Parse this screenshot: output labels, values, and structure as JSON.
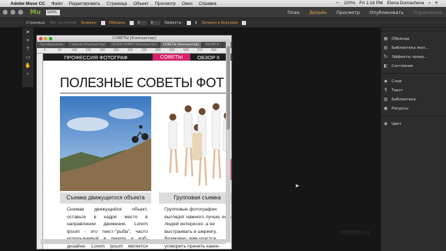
{
  "menubar": {
    "app": "Adobe Muse CC",
    "menus": [
      "Файл",
      "Редактировать",
      "Страница",
      "Объект",
      "Просмотр",
      "Окно",
      "Справка"
    ],
    "battery": "100%",
    "time": "Fri 1:18 PM",
    "user": "Elena Domasheva"
  },
  "appbar": {
    "logo": "Mu",
    "zoom": "100%",
    "tabs": [
      "План",
      "Дизайн",
      "Просмотр",
      "Опубликовать",
      "Управление"
    ],
    "active_tab": "Дизайн"
  },
  "optionsbar": {
    "page_label": "Страница:",
    "page_state": "Нет состояния",
    "fill_label": "Заливка:",
    "stroke_label": "Обводка:",
    "stroke_value": "0",
    "value2": "0",
    "effects_label": "Эффекты:",
    "browser_fill": "Заливка в браузере"
  },
  "tools": [
    "arrow-icon",
    "crop-icon",
    "text-icon",
    "rectangle-icon",
    "hand-icon",
    "zoom-icon"
  ],
  "document": {
    "window_title": "СОВЕТЫ [Компьютер]",
    "tabs": [
      "Преобразован",
      "Главная [Компьютер]",
      "ОБЗОР КАМЕР [Компьютер]",
      "СОВЕТЫ [Компьютер]",
      "ОБЗОР К"
    ],
    "active_tab": "СОВЕТЫ [Компьютер]",
    "ruler": [
      "0",
      "50",
      "100",
      "150",
      "200",
      "250",
      "300",
      "350",
      "400",
      "450",
      "500",
      "550",
      "600"
    ]
  },
  "site": {
    "nav": [
      "ПРОФЕССИЯ ФОТОГРАФ",
      "СОВЕТЫ",
      "ОБЗОР К"
    ],
    "title": "ПОЛЕЗНЫЕ СОВЕТЫ ФОТ",
    "card1": {
      "caption": "Съемка движущегося объекта",
      "text": "Снимая движущийся объект, оставьте в кадре место в направлении движения. Lorem Ipsum - это текст-\"рыба\", часто используемый в печати и вэб-дизайне. Lorem Ipsum является стандартной \"рыбой\" для"
    },
    "card2": {
      "caption": "Групповая съемка",
      "text": "Групповые фотографии выглядят намного лучше, если людей интересно, а не выстраивать в шеренгу. Возможно, вам удастся уговорить принять какие-нибудь интересные позы?"
    }
  },
  "panel": {
    "group1": [
      "Образцы",
      "Библиотека жел...",
      "Эффекты прокр...",
      "Состояния"
    ],
    "group2": [
      "Слои",
      "Текст",
      "Библиотека",
      "Ресурсы"
    ],
    "group3": [
      "Цвет"
    ]
  },
  "watermark": "master.ru"
}
